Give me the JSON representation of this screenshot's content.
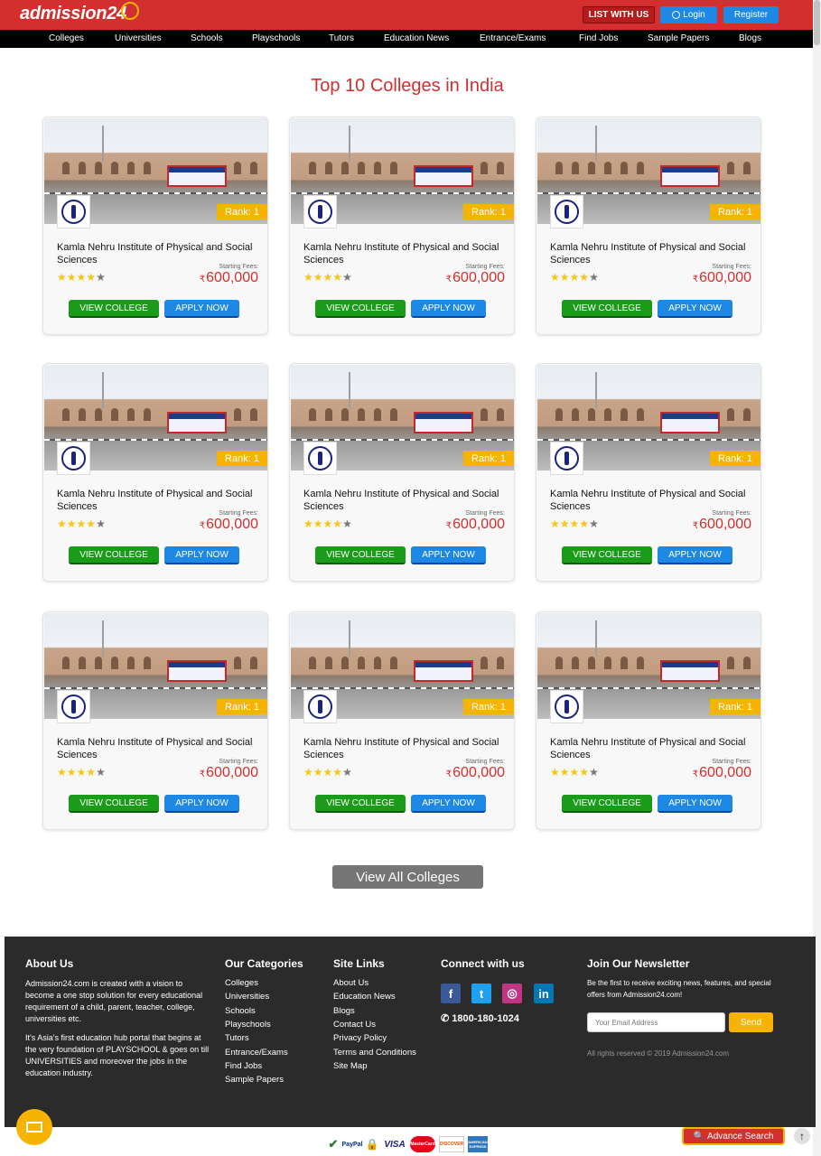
{
  "header": {
    "logo": "admission24",
    "list_btn": "LIST WITH US",
    "login_btn": "Login",
    "register_btn": "Register"
  },
  "nav": [
    "Colleges",
    "Universities",
    "Schools",
    "Playschools",
    "Tutors",
    "Education News",
    "Entrance/Exams",
    "Find Jobs",
    "Sample Papers",
    "Blogs"
  ],
  "section_title": "Top 10 Colleges in India",
  "colleges": [
    {
      "name": "Kamla Nehru Institute of Physical and Social Sciences",
      "rank": "Rank: 1",
      "stars": 4,
      "fee_label": "Starting Fees:",
      "currency": "₹",
      "fee": "600,000",
      "view_btn": "VIEW COLLEGE",
      "apply_btn": "APPLY NOW"
    },
    {
      "name": "Kamla Nehru Institute of Physical and Social Sciences",
      "rank": "Rank: 1",
      "stars": 4,
      "fee_label": "Starting Fees:",
      "currency": "₹",
      "fee": "600,000",
      "view_btn": "VIEW COLLEGE",
      "apply_btn": "APPLY NOW"
    },
    {
      "name": "Kamla Nehru Institute of Physical and Social Sciences",
      "rank": "Rank: 1",
      "stars": 4,
      "fee_label": "Starting Fees:",
      "currency": "₹",
      "fee": "600,000",
      "view_btn": "VIEW COLLEGE",
      "apply_btn": "APPLY NOW"
    },
    {
      "name": "Kamla Nehru Institute of Physical and Social Sciences",
      "rank": "Rank: 1",
      "stars": 4,
      "fee_label": "Starting Fees:",
      "currency": "₹",
      "fee": "600,000",
      "view_btn": "VIEW COLLEGE",
      "apply_btn": "APPLY NOW"
    },
    {
      "name": "Kamla Nehru Institute of Physical and Social Sciences",
      "rank": "Rank: 1",
      "stars": 4,
      "fee_label": "Starting Fees:",
      "currency": "₹",
      "fee": "600,000",
      "view_btn": "VIEW COLLEGE",
      "apply_btn": "APPLY NOW"
    },
    {
      "name": "Kamla Nehru Institute of Physical and Social Sciences",
      "rank": "Rank: 1",
      "stars": 4,
      "fee_label": "Starting Fees:",
      "currency": "₹",
      "fee": "600,000",
      "view_btn": "VIEW COLLEGE",
      "apply_btn": "APPLY NOW"
    },
    {
      "name": "Kamla Nehru Institute of Physical and Social Sciences",
      "rank": "Rank: 1",
      "stars": 4,
      "fee_label": "Starting Fees:",
      "currency": "₹",
      "fee": "600,000",
      "view_btn": "VIEW COLLEGE",
      "apply_btn": "APPLY NOW"
    },
    {
      "name": "Kamla Nehru Institute of Physical and Social Sciences",
      "rank": "Rank: 1",
      "stars": 4,
      "fee_label": "Starting Fees:",
      "currency": "₹",
      "fee": "600,000",
      "view_btn": "VIEW COLLEGE",
      "apply_btn": "APPLY NOW"
    },
    {
      "name": "Kamla Nehru Institute of Physical and Social Sciences",
      "rank": "Rank: 1",
      "stars": 4,
      "fee_label": "Starting Fees:",
      "currency": "₹",
      "fee": "600,000",
      "view_btn": "VIEW COLLEGE",
      "apply_btn": "APPLY NOW"
    }
  ],
  "view_all_btn": "View All Colleges",
  "footer": {
    "about": {
      "heading": "About Us",
      "p1": "Admission24.com is created with a vision to become a one stop solution for every educational requirement of a child, parent, teacher, college, universities etc.",
      "p2": "It's Asia's first education hub portal that begins at the very foundation of PLAYSCHOOL & goes on till UNIVERSITIES and moreover the jobs in the education industry."
    },
    "categories": {
      "heading": "Our Categories",
      "items": [
        "Colleges",
        "Universities",
        "Schools",
        "Playschools",
        "Tutors",
        "Entrance/Exams",
        "Find Jobs",
        "Sample Papers"
      ]
    },
    "site_links": {
      "heading": "Site Links",
      "items": [
        "About Us",
        "Education News",
        "Blogs",
        "Contact Us",
        "Privacy Policy",
        "Terms and Conditions",
        "Site Map"
      ]
    },
    "connect": {
      "heading": "Connect with us",
      "phone": "1800-180-1024"
    },
    "newsletter": {
      "heading": "Join Our Newsletter",
      "text": "Be the first to receive exciting news, features, and special offers from Admission24.com!",
      "placeholder": "Your Email Address",
      "send_btn": "Send",
      "copyright": "All rights reserved © 2019 Admission24.com"
    }
  },
  "payments": [
    "PayPal",
    "VISA",
    "MasterCard",
    "DISCOVER",
    "AMERICAN EXPRESS"
  ],
  "advance_search_btn": "Advance Search",
  "colors": {
    "brand_red": "#d32f2f",
    "accent_yellow": "#f6b400",
    "green": "#1a9c1a",
    "blue": "#1e88e5"
  }
}
